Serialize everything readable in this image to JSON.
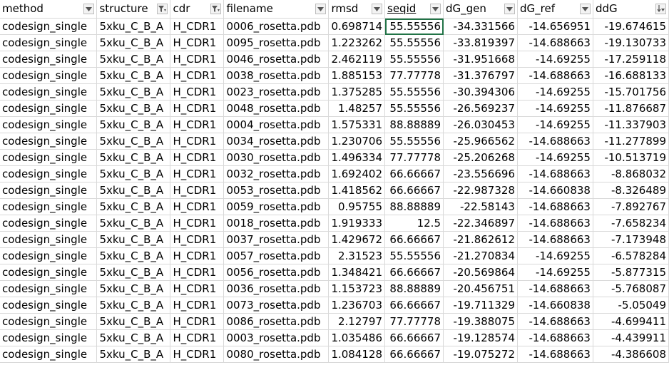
{
  "columns": [
    {
      "key": "method",
      "label": "method",
      "filter": "dropdown",
      "align": "left"
    },
    {
      "key": "structure",
      "label": "structure",
      "filter": "filtered",
      "align": "left"
    },
    {
      "key": "cdr",
      "label": "cdr",
      "filter": "filtered",
      "align": "left"
    },
    {
      "key": "filename",
      "label": "filename",
      "filter": "dropdown",
      "align": "left"
    },
    {
      "key": "rmsd",
      "label": "rmsd",
      "filter": "dropdown",
      "align": "right"
    },
    {
      "key": "seqid",
      "label": "seqid",
      "filter": "dropdown",
      "align": "right"
    },
    {
      "key": "dG_gen",
      "label": "dG_gen",
      "filter": "dropdown",
      "align": "right"
    },
    {
      "key": "dG_ref",
      "label": "dG_ref",
      "filter": "dropdown",
      "align": "right"
    },
    {
      "key": "ddG",
      "label": "ddG",
      "filter": "sorted-desc",
      "align": "right"
    }
  ],
  "rows": [
    [
      "codesign_single",
      "5xku_C_B_A",
      "H_CDR1",
      "0006_rosetta.pdb",
      "0.698714",
      "55.55556",
      "-34.331566",
      "-14.656951",
      "-19.674615"
    ],
    [
      "codesign_single",
      "5xku_C_B_A",
      "H_CDR1",
      "0095_rosetta.pdb",
      "1.223262",
      "55.55556",
      "-33.819397",
      "-14.688663",
      "-19.130733"
    ],
    [
      "codesign_single",
      "5xku_C_B_A",
      "H_CDR1",
      "0046_rosetta.pdb",
      "2.462119",
      "55.55556",
      "-31.951668",
      "-14.69255",
      "-17.259118"
    ],
    [
      "codesign_single",
      "5xku_C_B_A",
      "H_CDR1",
      "0038_rosetta.pdb",
      "1.885153",
      "77.77778",
      "-31.376797",
      "-14.688663",
      "-16.688133"
    ],
    [
      "codesign_single",
      "5xku_C_B_A",
      "H_CDR1",
      "0023_rosetta.pdb",
      "1.375285",
      "55.55556",
      "-30.394306",
      "-14.69255",
      "-15.701756"
    ],
    [
      "codesign_single",
      "5xku_C_B_A",
      "H_CDR1",
      "0048_rosetta.pdb",
      "1.48257",
      "55.55556",
      "-26.569237",
      "-14.69255",
      "-11.876687"
    ],
    [
      "codesign_single",
      "5xku_C_B_A",
      "H_CDR1",
      "0004_rosetta.pdb",
      "1.575331",
      "88.88889",
      "-26.030453",
      "-14.69255",
      "-11.337903"
    ],
    [
      "codesign_single",
      "5xku_C_B_A",
      "H_CDR1",
      "0034_rosetta.pdb",
      "1.230706",
      "55.55556",
      "-25.966562",
      "-14.688663",
      "-11.277899"
    ],
    [
      "codesign_single",
      "5xku_C_B_A",
      "H_CDR1",
      "0030_rosetta.pdb",
      "1.496334",
      "77.77778",
      "-25.206268",
      "-14.69255",
      "-10.513719"
    ],
    [
      "codesign_single",
      "5xku_C_B_A",
      "H_CDR1",
      "0032_rosetta.pdb",
      "1.692402",
      "66.66667",
      "-23.556696",
      "-14.688663",
      "-8.868032"
    ],
    [
      "codesign_single",
      "5xku_C_B_A",
      "H_CDR1",
      "0053_rosetta.pdb",
      "1.418562",
      "66.66667",
      "-22.987328",
      "-14.660838",
      "-8.326489"
    ],
    [
      "codesign_single",
      "5xku_C_B_A",
      "H_CDR1",
      "0059_rosetta.pdb",
      "0.95755",
      "88.88889",
      "-22.58143",
      "-14.688663",
      "-7.892767"
    ],
    [
      "codesign_single",
      "5xku_C_B_A",
      "H_CDR1",
      "0018_rosetta.pdb",
      "1.919333",
      "12.5",
      "-22.346897",
      "-14.688663",
      "-7.658234"
    ],
    [
      "codesign_single",
      "5xku_C_B_A",
      "H_CDR1",
      "0037_rosetta.pdb",
      "1.429672",
      "66.66667",
      "-21.862612",
      "-14.688663",
      "-7.173948"
    ],
    [
      "codesign_single",
      "5xku_C_B_A",
      "H_CDR1",
      "0057_rosetta.pdb",
      "2.31523",
      "55.55556",
      "-21.270834",
      "-14.69255",
      "-6.578284"
    ],
    [
      "codesign_single",
      "5xku_C_B_A",
      "H_CDR1",
      "0056_rosetta.pdb",
      "1.348421",
      "66.66667",
      "-20.569864",
      "-14.69255",
      "-5.877315"
    ],
    [
      "codesign_single",
      "5xku_C_B_A",
      "H_CDR1",
      "0036_rosetta.pdb",
      "1.153723",
      "88.88889",
      "-20.456751",
      "-14.688663",
      "-5.768087"
    ],
    [
      "codesign_single",
      "5xku_C_B_A",
      "H_CDR1",
      "0073_rosetta.pdb",
      "1.236703",
      "66.66667",
      "-19.711329",
      "-14.660838",
      "-5.05049"
    ],
    [
      "codesign_single",
      "5xku_C_B_A",
      "H_CDR1",
      "0086_rosetta.pdb",
      "2.12797",
      "77.77778",
      "-19.388075",
      "-14.688663",
      "-4.699411"
    ],
    [
      "codesign_single",
      "5xku_C_B_A",
      "H_CDR1",
      "0003_rosetta.pdb",
      "1.035486",
      "66.66667",
      "-19.128574",
      "-14.688663",
      "-4.439911"
    ],
    [
      "codesign_single",
      "5xku_C_B_A",
      "H_CDR1",
      "0080_rosetta.pdb",
      "1.084128",
      "66.66667",
      "-19.075272",
      "-14.688663",
      "-4.386608"
    ]
  ],
  "selected_cell": {
    "row": 0,
    "column": "seqid"
  },
  "colors": {
    "grid": "#d9d9d9",
    "selection": "#217346",
    "filter_bg": "#f3f3f3"
  }
}
